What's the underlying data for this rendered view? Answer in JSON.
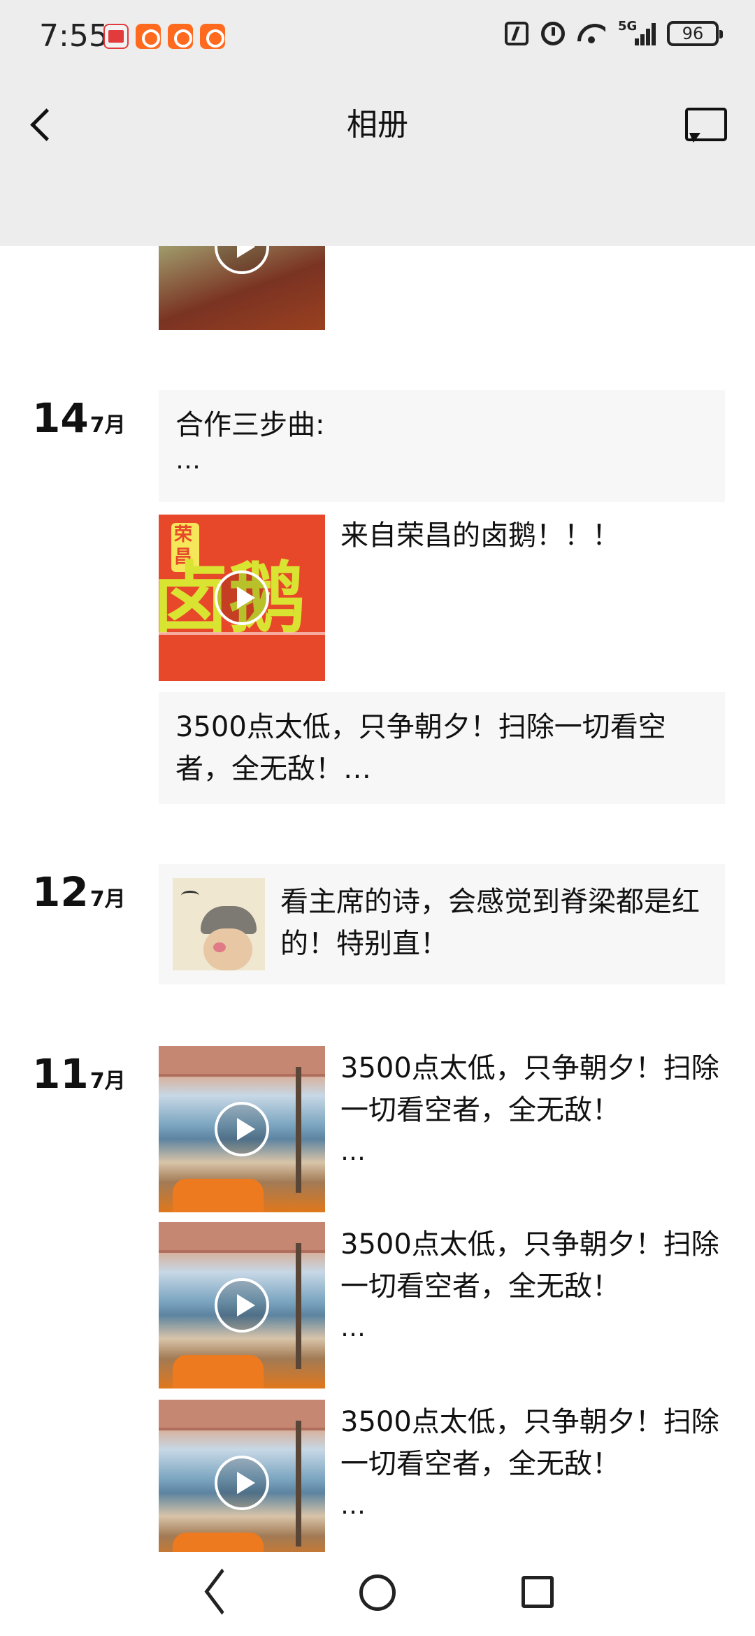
{
  "status_bar": {
    "time": "7:55",
    "network": "5G",
    "battery": "96"
  },
  "nav": {
    "title": "相册"
  },
  "groups": [
    {
      "day": "14",
      "month": "7月",
      "items": [
        {
          "type": "text",
          "text": "合作三步曲:",
          "ellipsis": "…"
        },
        {
          "type": "video",
          "caption": "来自荣昌的卤鹅！！！",
          "thumb_text": [
            "荣",
            "昌",
            "卤鹅"
          ]
        },
        {
          "type": "text",
          "text": "3500点太低，只争朝夕！扫除一切看空者，全无敌！…"
        }
      ]
    },
    {
      "day": "12",
      "month": "7月",
      "items": [
        {
          "type": "image",
          "caption": "看主席的诗，会感觉到脊梁都是红的！特别直！"
        }
      ]
    },
    {
      "day": "11",
      "month": "7月",
      "items": [
        {
          "type": "video",
          "caption": "3500点太低，只争朝夕！扫除一切看空者，全无敌！",
          "ellipsis": "…"
        },
        {
          "type": "video",
          "caption": "3500点太低，只争朝夕！扫除一切看空者，全无敌！",
          "ellipsis": "…"
        },
        {
          "type": "video",
          "caption": "3500点太低，只争朝夕！扫除一切看空者，全无敌！",
          "ellipsis": "…"
        }
      ]
    }
  ],
  "colors": {
    "header_bg": "#ededed",
    "card_bg": "#f7f7f7",
    "text": "#111111"
  }
}
